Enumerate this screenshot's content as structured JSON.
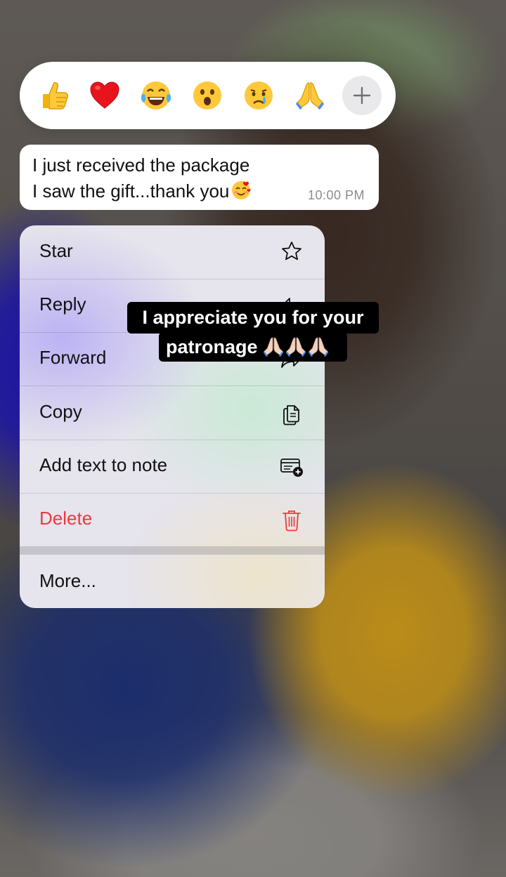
{
  "reactions": [
    {
      "name": "thumbs-up",
      "glyph": "👍"
    },
    {
      "name": "red-heart",
      "glyph": "❤️"
    },
    {
      "name": "tears-of-joy",
      "glyph": "😂"
    },
    {
      "name": "surprised",
      "glyph": "😮"
    },
    {
      "name": "crying",
      "glyph": "😢"
    },
    {
      "name": "folded-hands",
      "glyph": "🙏"
    }
  ],
  "reaction_more_icon": "plus-icon",
  "message": {
    "line1": "I just received the package",
    "line2": "I saw the gift...thank you",
    "line2_emoji": "smiling-face-with-hearts",
    "time": "10:00 PM"
  },
  "menu": {
    "items": [
      {
        "label": "Star",
        "icon": "star-icon"
      },
      {
        "label": "Reply",
        "icon": "reply-icon"
      },
      {
        "label": "Forward",
        "icon": "forward-icon"
      },
      {
        "label": "Copy",
        "icon": "copy-icon"
      },
      {
        "label": "Add text to note",
        "icon": "add-note-icon"
      },
      {
        "label": "Delete",
        "icon": "trash-icon",
        "color": "#ea3a3e"
      }
    ],
    "more_label": "More..."
  },
  "caption": {
    "line1": "I appreciate you for your",
    "line2": "patronage",
    "line2_emoji": "folded-hands x3"
  }
}
